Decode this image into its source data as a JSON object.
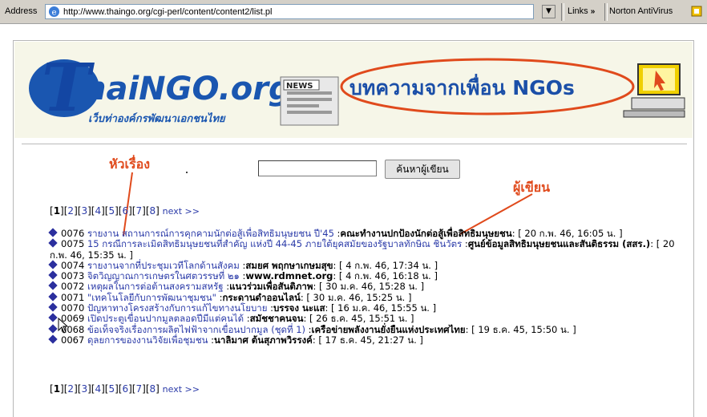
{
  "browser": {
    "address_label": "Address",
    "url": "http://www.thaingo.org/cgi-perl/content/content2/list.pl",
    "links_label": "Links",
    "links_chevron": "»",
    "toolbar_item": "Norton AntiVirus"
  },
  "banner": {
    "logo_text": "ThaiNGO.org",
    "logo_subtitle": "เว็บท่าองค์กรพัฒนาเอกชนไทย",
    "news_label": "NEWS",
    "heading": "บทความจากเพื่อน NGOs"
  },
  "annotations": {
    "title_label": "หัวเรื่อง",
    "author_label": "ผู้เขียน",
    "colors": {
      "annotation": "#e04a1c"
    }
  },
  "search": {
    "input_value": "",
    "button_label": "ค้นหาผู้เขียน"
  },
  "pager": {
    "pages": [
      "1",
      "2",
      "3",
      "4",
      "5",
      "6",
      "7",
      "8"
    ],
    "current": "1",
    "next_label": "next >>"
  },
  "articles": [
    {
      "id": "0076",
      "title": "รายงาน สถานการณ์การคุกคามนักต่อสู้เพื่อสิทธิมนุษยชน ปี'45",
      "author": "คณะทำงานปกป้องนักต่อสู้เพื่อสิทธิมนุษยชน",
      "date": "20 ก.พ. 46, 16:05 น."
    },
    {
      "id": "0075",
      "title": "15 กรณีการละเมิดสิทธิมนุษยชนที่สำคัญ แห่งปี 44-45 ภายใต้ยุคสมัยของรัฐบาลทักษิณ ชินวัตร",
      "author": "ศูนย์ข้อมูลสิทธิมนุษยชนและสันติธรรม (สสร.)",
      "date": "20 ก.พ. 46, 15:35 น."
    },
    {
      "id": "0074",
      "title": "รายงานจากที่ประชุมเวทีโลกด้านสังคม",
      "author": "สมยศ พฤกษาเกษมสุข",
      "date": "4 ก.พ. 46, 17:34 น."
    },
    {
      "id": "0073",
      "title": "จิตวิญญาณการเกษตรในศตวรรษที่ ๒๑",
      "author": "www.rdmnet.org",
      "date": "4 ก.พ. 46, 16:18 น."
    },
    {
      "id": "0072",
      "title": "เหตุผลในการต่อต้านสงครามสหรัฐ",
      "author": "แนวร่วมเพื่อสันติภาพ",
      "date": "30 ม.ค. 46, 15:28 น."
    },
    {
      "id": "0071",
      "title": "\"เทคโนโลยีกับการพัฒนาชุมชน\"",
      "author": "กระดานดำออนไลน์",
      "date": "30 ม.ค. 46, 15:25 น."
    },
    {
      "id": "0070",
      "title": "ปัญหาทางโครงสร้างกับการแก้ไขทางนโยบาย",
      "author": "บรรจง นะแส",
      "date": "16 ม.ค. 46, 15:55 น."
    },
    {
      "id": "0069",
      "title": "เปิดประตูเขื่อนปากมูลตลอดปีมีแต่คนได้",
      "author": "สมัชชาคนจน",
      "date": "26 ธ.ค. 45, 15:51 น."
    },
    {
      "id": "0068",
      "title": "ข้อเท็จจริงเรื่องการผลิตไฟฟ้าจากเขื่อนปากมูล (ชุดที่ 1)",
      "author": "เครือข่ายพลังงานยั่งยืนแห่งประเทศไทย",
      "date": "19 ธ.ค. 45, 15:50 น."
    },
    {
      "id": "0067",
      "title": "ดุลยการของงานวิจัยเพื่อชุมชน",
      "author": "นาลิมาศ ต้นสุภาพวิรรงค์",
      "date": "17 ธ.ค. 45, 21:27 น."
    }
  ]
}
